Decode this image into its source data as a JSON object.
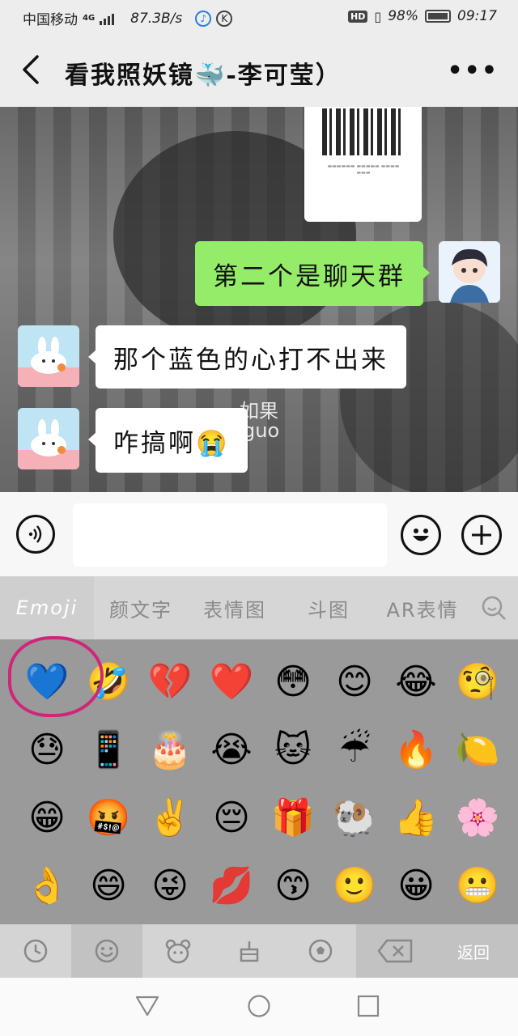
{
  "status": {
    "carrier": "中国移动",
    "network": "4G",
    "speed": "87.3B/s",
    "hd": "HD",
    "battery": "98%",
    "time": "09:17"
  },
  "header": {
    "title": "看我照妖镜🐳-李可莹）",
    "more": "•••"
  },
  "chat": {
    "messages": [
      {
        "side": "right",
        "text": "第二个是聊天群"
      },
      {
        "side": "left",
        "text": "那个蓝色的心打不出来"
      },
      {
        "side": "left",
        "text": "咋搞啊😭"
      }
    ],
    "watermark_line1": "如果",
    "watermark_line2": "guo"
  },
  "emoji_panel": {
    "tabs": [
      "Emoji",
      "颜文字",
      "表情图",
      "斗图",
      "AR表情"
    ],
    "active_tab": "Emoji",
    "rows": [
      [
        "💙",
        "🤣",
        "💔",
        "❤️",
        "😳",
        "😊",
        "😂",
        "🧐"
      ],
      [
        "😓",
        "📱",
        "🎂",
        "😭",
        "🐱",
        "☔",
        "🔥",
        "🍋"
      ],
      [
        "😁",
        "🤬",
        "✌️",
        "😔",
        "🎁",
        "🐏",
        "👍",
        "🌸"
      ],
      [
        "👌",
        "😄",
        "😜",
        "💋",
        "😙",
        "🙂",
        "😀",
        "😬"
      ]
    ],
    "return_label": "返回"
  }
}
